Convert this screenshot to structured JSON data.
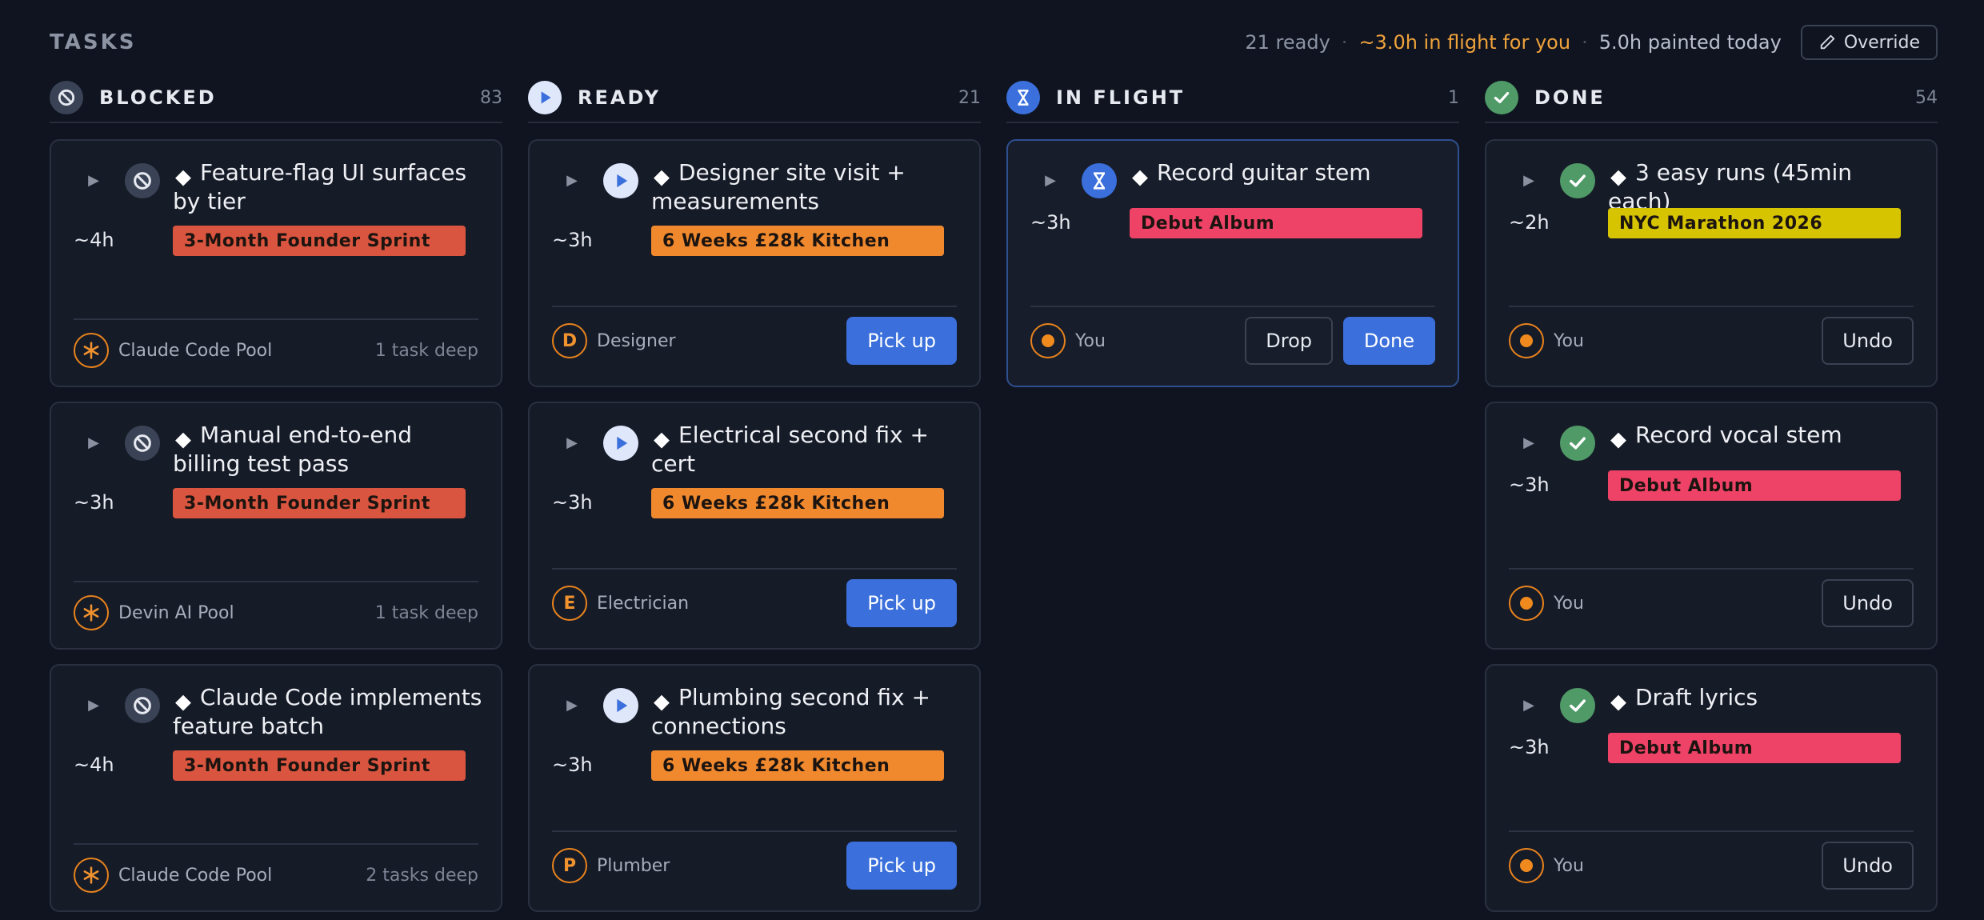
{
  "page": {
    "title": "TASKS"
  },
  "stats": {
    "ready": "21 ready",
    "inflight": "~3.0h in flight for you",
    "painted": "5.0h painted today",
    "separator": "·",
    "override_label": "Override"
  },
  "columns": [
    {
      "key": "blocked",
      "title": "BLOCKED",
      "count": "83",
      "icon": "blocked-icon"
    },
    {
      "key": "ready",
      "title": "READY",
      "count": "21",
      "icon": "play-icon"
    },
    {
      "key": "inflight",
      "title": "IN FLIGHT",
      "count": "1",
      "icon": "hourglass-icon"
    },
    {
      "key": "done",
      "title": "DONE",
      "count": "54",
      "icon": "check-icon"
    }
  ],
  "colors": {
    "founder_sprint": "#d9553f",
    "kitchen": "#f0892e",
    "debut_album": "#ee4266",
    "marathon": "#d6c400",
    "primary_button": "#3a6fdc",
    "assignee_accent": "#e8831d"
  },
  "blocked": [
    {
      "title": "Feature-flag UI surfaces by tier",
      "estimate": "~4h",
      "tag": "3-Month Founder Sprint",
      "assignee": "Claude Code Pool",
      "depth": "1 task deep"
    },
    {
      "title": "Manual end-to-end billing test pass",
      "estimate": "~3h",
      "tag": "3-Month Founder Sprint",
      "assignee": "Devin AI Pool",
      "depth": "1 task deep"
    },
    {
      "title": "Claude Code implements feature batch",
      "estimate": "~4h",
      "tag": "3-Month Founder Sprint",
      "assignee": "Claude Code Pool",
      "depth": "2 tasks deep"
    }
  ],
  "ready": [
    {
      "title": "Designer site visit + measurements",
      "estimate": "~3h",
      "tag": "6 Weeks £28k Kitchen",
      "assignee_initial": "D",
      "assignee": "Designer",
      "action": "Pick up"
    },
    {
      "title": "Electrical second fix + cert",
      "estimate": "~3h",
      "tag": "6 Weeks £28k Kitchen",
      "assignee_initial": "E",
      "assignee": "Electrician",
      "action": "Pick up"
    },
    {
      "title": "Plumbing second fix + connections",
      "estimate": "~3h",
      "tag": "6 Weeks £28k Kitchen",
      "assignee_initial": "P",
      "assignee": "Plumber",
      "action": "Pick up"
    }
  ],
  "inflight": [
    {
      "title": "Record guitar stem",
      "estimate": "~3h",
      "tag": "Debut Album",
      "assignee": "You",
      "drop_label": "Drop",
      "done_label": "Done"
    }
  ],
  "done": [
    {
      "title": "3 easy runs (45min each)",
      "estimate": "~2h",
      "tag": "NYC Marathon 2026",
      "assignee": "You",
      "action": "Undo"
    },
    {
      "title": "Record vocal stem",
      "estimate": "~3h",
      "tag": "Debut Album",
      "assignee": "You",
      "action": "Undo"
    },
    {
      "title": "Draft lyrics",
      "estimate": "~3h",
      "tag": "Debut Album",
      "assignee": "You",
      "action": "Undo"
    }
  ]
}
